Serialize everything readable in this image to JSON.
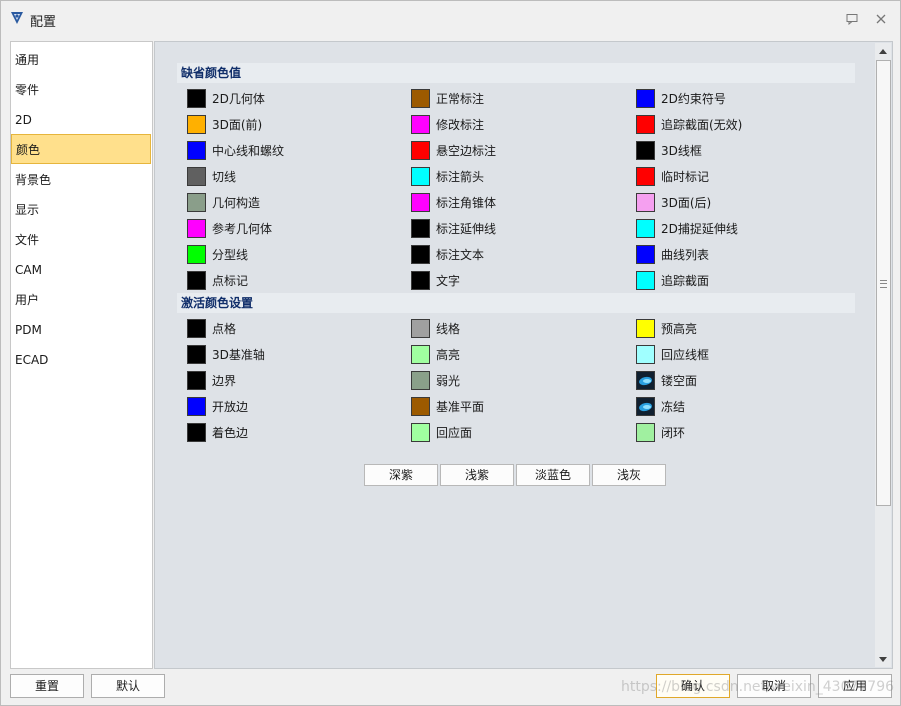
{
  "window": {
    "title": "配置"
  },
  "sidebar": {
    "items": [
      {
        "label": "通用"
      },
      {
        "label": "零件"
      },
      {
        "label": "2D"
      },
      {
        "label": "颜色",
        "selected": true
      },
      {
        "label": "背景色"
      },
      {
        "label": "显示"
      },
      {
        "label": "文件"
      },
      {
        "label": "CAM"
      },
      {
        "label": "用户"
      },
      {
        "label": "PDM"
      },
      {
        "label": "ECAD"
      }
    ]
  },
  "default_colors": {
    "title": "缺省颜色值",
    "items": [
      {
        "label": "2D几何体",
        "color": "#000000"
      },
      {
        "label": "正常标注",
        "color": "#9c5a00"
      },
      {
        "label": "2D约束符号",
        "color": "#0000ff"
      },
      {
        "label": "3D面(前)",
        "color": "#ffb000"
      },
      {
        "label": "修改标注",
        "color": "#ff00ff"
      },
      {
        "label": "追踪截面(无效)",
        "color": "#ff0000"
      },
      {
        "label": "中心线和螺纹",
        "color": "#0000ff"
      },
      {
        "label": "悬空边标注",
        "color": "#ff0000"
      },
      {
        "label": "3D线框",
        "color": "#000000"
      },
      {
        "label": "切线",
        "color": "#606060"
      },
      {
        "label": "标注箭头",
        "color": "#00ffff"
      },
      {
        "label": "临时标记",
        "color": "#ff0000"
      },
      {
        "label": "几何构造",
        "color": "#8a9e8a"
      },
      {
        "label": "标注角锥体",
        "color": "#ff00ff"
      },
      {
        "label": "3D面(后)",
        "color": "#f5a0f0"
      },
      {
        "label": "参考几何体",
        "color": "#ff00ff"
      },
      {
        "label": "标注延伸线",
        "color": "#000000"
      },
      {
        "label": "2D捕捉延伸线",
        "color": "#00ffff"
      },
      {
        "label": "分型线",
        "color": "#00ff00"
      },
      {
        "label": "标注文本",
        "color": "#000000"
      },
      {
        "label": "曲线列表",
        "color": "#0000ff"
      },
      {
        "label": "点标记",
        "color": "#000000"
      },
      {
        "label": "文字",
        "color": "#000000"
      },
      {
        "label": "追踪截面",
        "color": "#00ffff"
      }
    ]
  },
  "active_colors": {
    "title": "激活颜色设置",
    "items": [
      {
        "label": "点格",
        "color": "#000000"
      },
      {
        "label": "线格",
        "color": "#a0a0a0"
      },
      {
        "label": "预高亮",
        "color": "#ffff00"
      },
      {
        "label": "3D基准轴",
        "color": "#000000"
      },
      {
        "label": "高亮",
        "color": "#a0ffa0"
      },
      {
        "label": "回应线框",
        "color": "#a0ffff"
      },
      {
        "label": "边界",
        "color": "#000000"
      },
      {
        "label": "弱光",
        "color": "#8aa08a"
      },
      {
        "label": "镂空面",
        "color": "#102030",
        "icon": "hollow-face-icon"
      },
      {
        "label": "开放边",
        "color": "#0000ff"
      },
      {
        "label": "基准平面",
        "color": "#9c5a00"
      },
      {
        "label": "冻结",
        "color": "#102030",
        "icon": "frozen-icon"
      },
      {
        "label": "着色边",
        "color": "#000000"
      },
      {
        "label": "回应面",
        "color": "#a0ffa0"
      },
      {
        "label": "闭环",
        "color": "#a0f0a0"
      }
    ]
  },
  "presets": [
    "深紫",
    "浅紫",
    "淡蓝色",
    "浅灰"
  ],
  "footer": {
    "reset_label": "重置",
    "default_label": "默认",
    "ok_label": "确认",
    "cancel_label": "取消",
    "apply_label": "应用",
    "watermark": "https://blog.csdn.net/weixin_43071796"
  }
}
